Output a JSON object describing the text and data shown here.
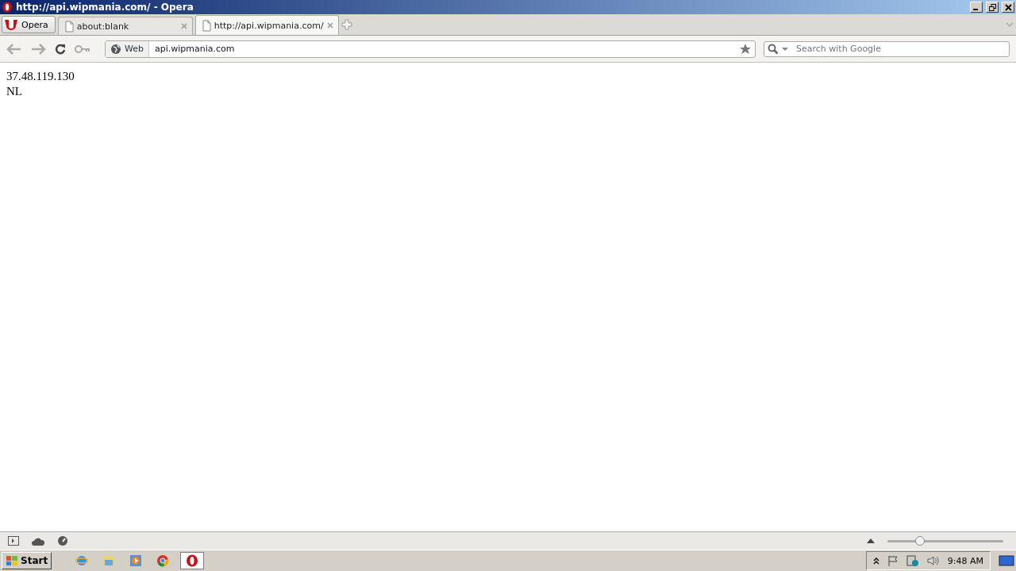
{
  "window": {
    "title": "http://api.wipmania.com/ - Opera"
  },
  "menu_button": {
    "label": "Opera"
  },
  "tabs": [
    {
      "label": "about:blank",
      "selected": false
    },
    {
      "label": "http://api.wipmania.com/",
      "selected": true
    }
  ],
  "address_bar": {
    "badge": "Web",
    "value": "api.wipmania.com"
  },
  "search": {
    "placeholder": "Search with Google"
  },
  "content": {
    "lines": [
      "37.48.119.130",
      "NL"
    ]
  },
  "status_bar": {
    "zoom": {
      "level": 0.28
    }
  },
  "taskbar": {
    "start": "Start",
    "items": [
      {
        "kind": "ie",
        "selected": false
      },
      {
        "kind": "folder",
        "selected": false
      },
      {
        "kind": "media",
        "selected": false
      },
      {
        "kind": "chrome",
        "selected": false
      },
      {
        "kind": "opera",
        "selected": true
      }
    ],
    "clock": "9:48 AM"
  }
}
